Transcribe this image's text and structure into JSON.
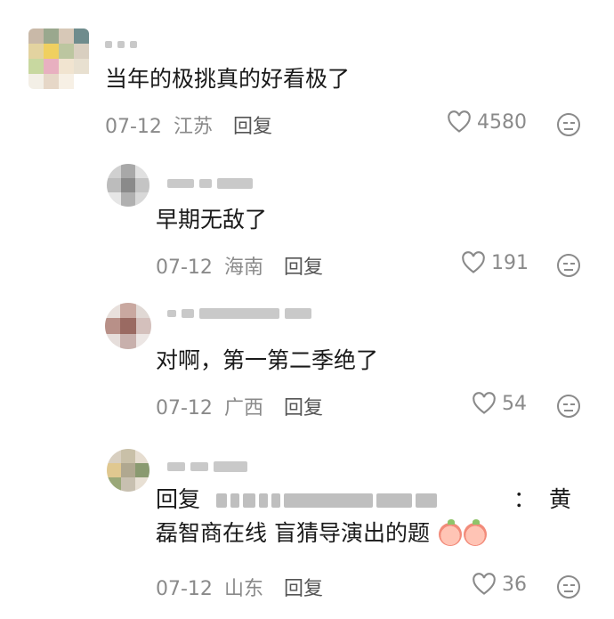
{
  "comments": [
    {
      "text": "当年的极挑真的好看极了",
      "date": "07-12",
      "location": "江苏",
      "reply_label": "回复",
      "likes": "4580"
    },
    {
      "text": "早期无敌了",
      "date": "07-12",
      "location": "海南",
      "reply_label": "回复",
      "likes": "191"
    },
    {
      "text": "对啊，第一第二季绝了",
      "date": "07-12",
      "location": "广西",
      "reply_label": "回复",
      "likes": "54"
    },
    {
      "reply_prefix": "回复",
      "separator": "：",
      "text_line1_end": "黄",
      "text_line2": "磊智商在线 盲猜导演出的题",
      "date": "07-12",
      "location": "山东",
      "reply_label": "回复",
      "likes": "36"
    }
  ],
  "icons": {
    "like": "heart-outline-icon",
    "react": "smiley-icon",
    "emoji": "peach-emoji-icon"
  },
  "colors": {
    "text": "#1a1a1a",
    "meta": "#8a8a8a",
    "reply": "#555555"
  }
}
